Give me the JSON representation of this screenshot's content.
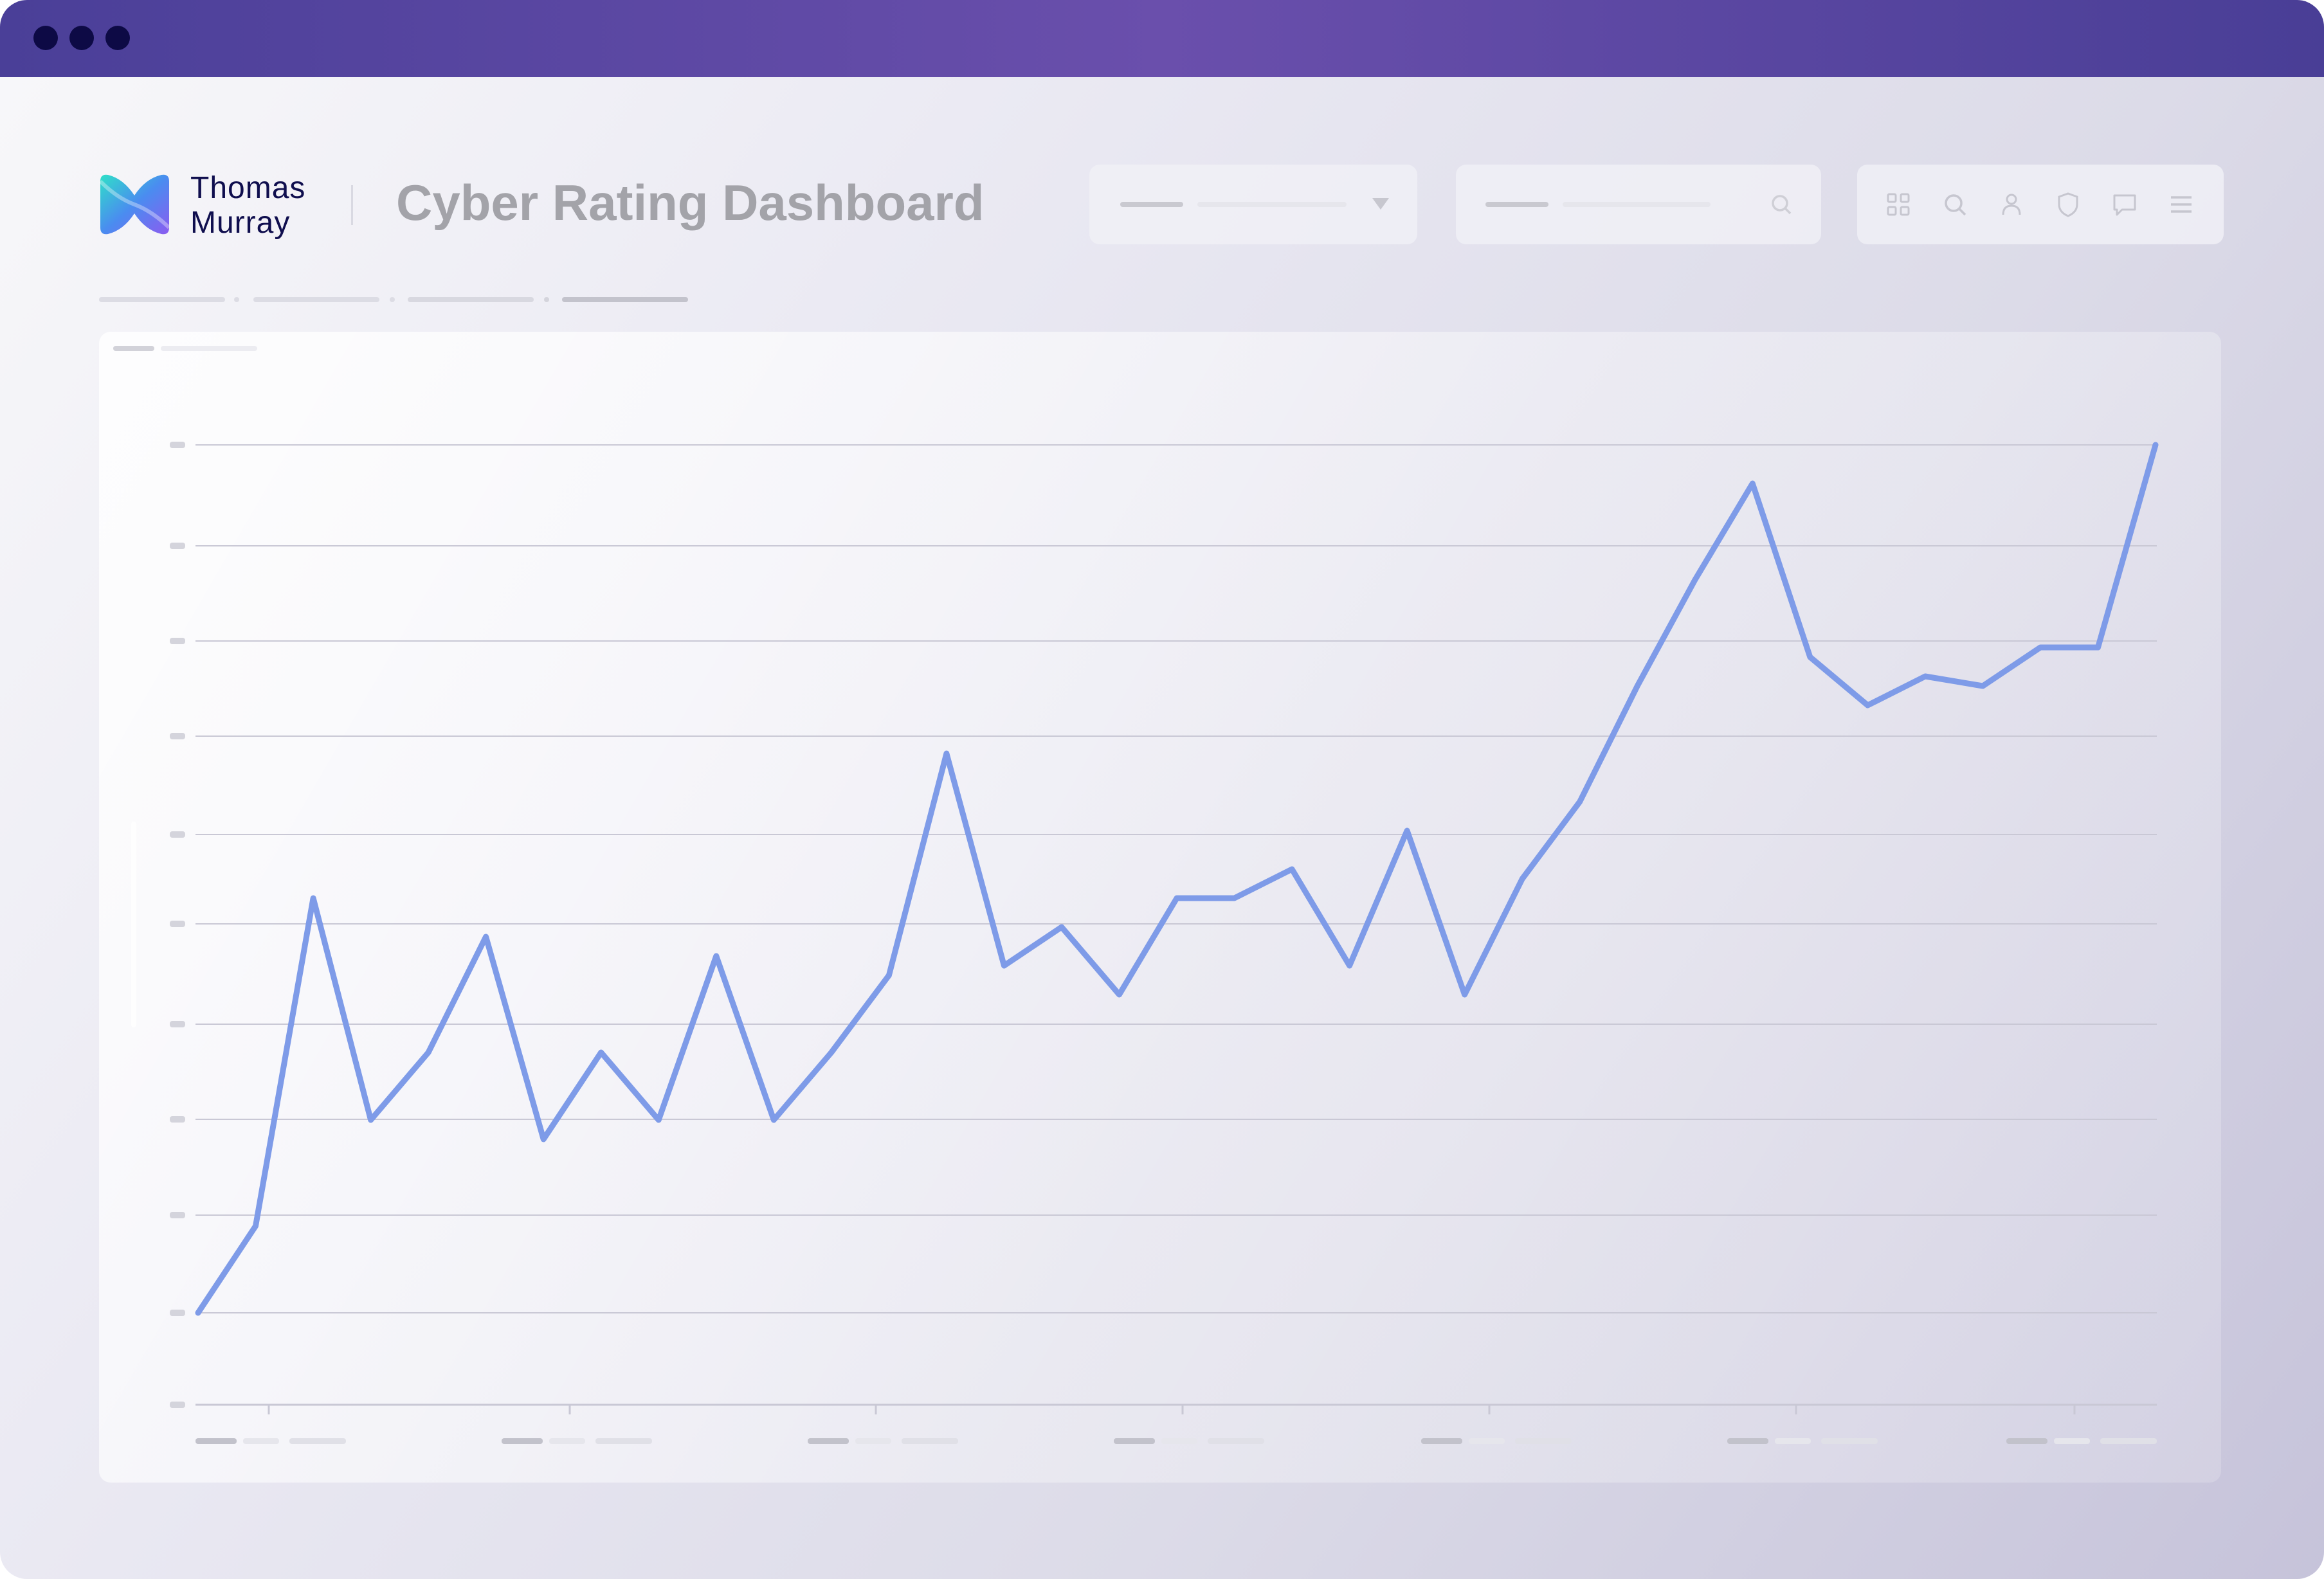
{
  "window": {
    "title": "",
    "traffic_light_color": "#0d0a45",
    "titlebar_colors": [
      "#4a3f98",
      "#6a4fac"
    ]
  },
  "header": {
    "brand_line1": "Thomas",
    "brand_line2": "Murray",
    "logo_icon": "brand-logo-icon",
    "title": "Cyber Rating Dashboard",
    "toolbar_icons": [
      "grid-icon",
      "search-icon",
      "user-icon",
      "shield-icon",
      "chat-icon",
      "menu-icon"
    ]
  },
  "chart_data": {
    "type": "line",
    "title": "",
    "xlabel": "",
    "ylabel": "",
    "x": [
      0,
      1,
      2,
      3,
      4,
      5,
      6,
      7,
      8,
      9,
      10,
      11,
      12,
      13,
      14,
      15,
      16,
      17,
      18,
      19,
      20,
      21,
      22,
      23,
      24,
      25,
      26,
      27,
      28,
      29,
      30,
      31,
      32,
      33,
      34
    ],
    "values": [
      0.0,
      0.9,
      4.3,
      2.0,
      2.7,
      3.9,
      1.8,
      2.7,
      2.0,
      3.7,
      2.0,
      2.7,
      3.5,
      5.8,
      3.6,
      4.0,
      3.3,
      4.3,
      4.3,
      4.6,
      3.6,
      5.0,
      3.3,
      4.5,
      5.3,
      6.5,
      7.6,
      8.6,
      6.8,
      6.3,
      6.6,
      6.5,
      6.9,
      6.9,
      9.0
    ],
    "ylim": [
      -1,
      9
    ],
    "grid": true,
    "line_color": "#7e9be8",
    "grid_color": "#c9c8d5"
  }
}
